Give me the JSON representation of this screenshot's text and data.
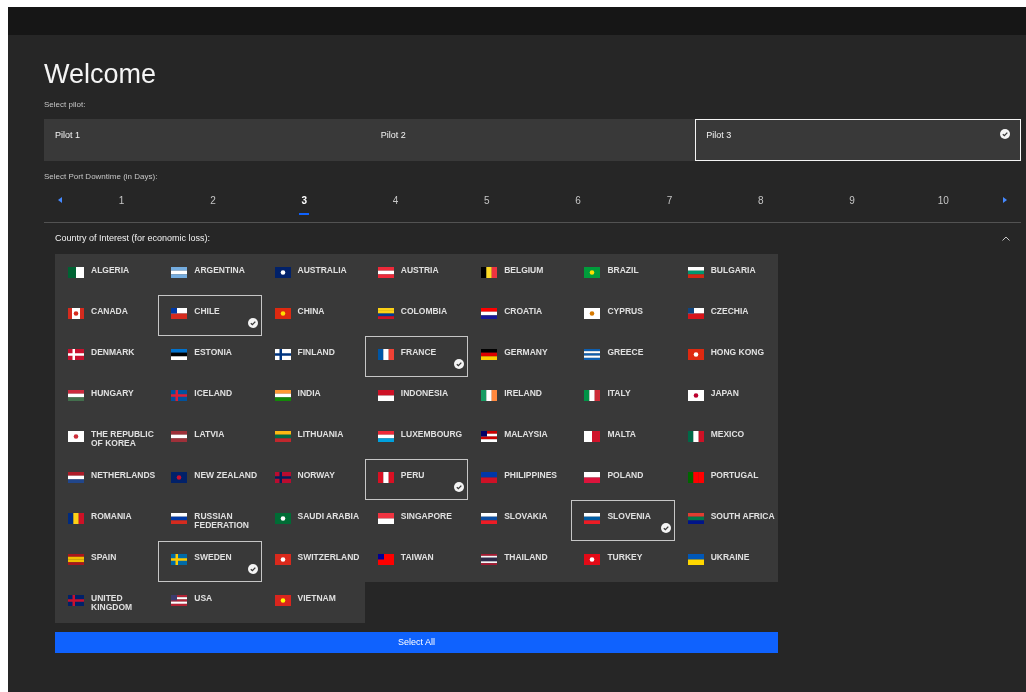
{
  "title": "Welcome",
  "pilot_label": "Select pilot:",
  "pilots": [
    {
      "label": "Pilot 1",
      "selected": false
    },
    {
      "label": "Pilot 2",
      "selected": false
    },
    {
      "label": "Pilot 3",
      "selected": true
    }
  ],
  "downtime_label": "Select Port Downtime (in Days):",
  "days": [
    {
      "label": "1",
      "selected": false
    },
    {
      "label": "2",
      "selected": false
    },
    {
      "label": "3",
      "selected": true
    },
    {
      "label": "4",
      "selected": false
    },
    {
      "label": "5",
      "selected": false
    },
    {
      "label": "6",
      "selected": false
    },
    {
      "label": "7",
      "selected": false
    },
    {
      "label": "8",
      "selected": false
    },
    {
      "label": "9",
      "selected": false
    },
    {
      "label": "10",
      "selected": false
    }
  ],
  "countries_section": {
    "title": "Country of Interest (for economic loss):",
    "expanded": true
  },
  "countries": [
    {
      "label": "ALGERIA",
      "selected": false
    },
    {
      "label": "ARGENTINA",
      "selected": false
    },
    {
      "label": "AUSTRALIA",
      "selected": false
    },
    {
      "label": "AUSTRIA",
      "selected": false
    },
    {
      "label": "BELGIUM",
      "selected": false
    },
    {
      "label": "BRAZIL",
      "selected": false
    },
    {
      "label": "BULGARIA",
      "selected": false
    },
    {
      "label": "CANADA",
      "selected": false
    },
    {
      "label": "CHILE",
      "selected": true
    },
    {
      "label": "CHINA",
      "selected": false
    },
    {
      "label": "COLOMBIA",
      "selected": false
    },
    {
      "label": "CROATIA",
      "selected": false
    },
    {
      "label": "CYPRUS",
      "selected": false
    },
    {
      "label": "CZECHIA",
      "selected": false
    },
    {
      "label": "DENMARK",
      "selected": false
    },
    {
      "label": "ESTONIA",
      "selected": false
    },
    {
      "label": "FINLAND",
      "selected": false
    },
    {
      "label": "FRANCE",
      "selected": true
    },
    {
      "label": "GERMANY",
      "selected": false
    },
    {
      "label": "GREECE",
      "selected": false
    },
    {
      "label": "HONG KONG",
      "selected": false
    },
    {
      "label": "HUNGARY",
      "selected": false
    },
    {
      "label": "ICELAND",
      "selected": false
    },
    {
      "label": "INDIA",
      "selected": false
    },
    {
      "label": "INDONESIA",
      "selected": false
    },
    {
      "label": "IRELAND",
      "selected": false
    },
    {
      "label": "ITALY",
      "selected": false
    },
    {
      "label": "JAPAN",
      "selected": false
    },
    {
      "label": "THE REPUBLIC OF KOREA",
      "selected": false
    },
    {
      "label": "LATVIA",
      "selected": false
    },
    {
      "label": "LITHUANIA",
      "selected": false
    },
    {
      "label": "LUXEMBOURG",
      "selected": false
    },
    {
      "label": "MALAYSIA",
      "selected": false
    },
    {
      "label": "MALTA",
      "selected": false
    },
    {
      "label": "MEXICO",
      "selected": false
    },
    {
      "label": "NETHERLANDS",
      "selected": false
    },
    {
      "label": "NEW ZEALAND",
      "selected": false
    },
    {
      "label": "NORWAY",
      "selected": false
    },
    {
      "label": "PERU",
      "selected": true
    },
    {
      "label": "PHILIPPINES",
      "selected": false
    },
    {
      "label": "POLAND",
      "selected": false
    },
    {
      "label": "PORTUGAL",
      "selected": false
    },
    {
      "label": "ROMANIA",
      "selected": false
    },
    {
      "label": "RUSSIAN FEDERATION",
      "selected": false
    },
    {
      "label": "SAUDI ARABIA",
      "selected": false
    },
    {
      "label": "SINGAPORE",
      "selected": false
    },
    {
      "label": "SLOVAKIA",
      "selected": false
    },
    {
      "label": "SLOVENIA",
      "selected": true
    },
    {
      "label": "SOUTH AFRICA",
      "selected": false
    },
    {
      "label": "SPAIN",
      "selected": false
    },
    {
      "label": "SWEDEN",
      "selected": true
    },
    {
      "label": "SWITZERLAND",
      "selected": false
    },
    {
      "label": "TAIWAN",
      "selected": false
    },
    {
      "label": "THAILAND",
      "selected": false
    },
    {
      "label": "TURKEY",
      "selected": false
    },
    {
      "label": "UKRAINE",
      "selected": false
    },
    {
      "label": "UNITED KINGDOM",
      "selected": false
    },
    {
      "label": "USA",
      "selected": false
    },
    {
      "label": "VIETNAM",
      "selected": false
    }
  ],
  "select_all": "Select All"
}
